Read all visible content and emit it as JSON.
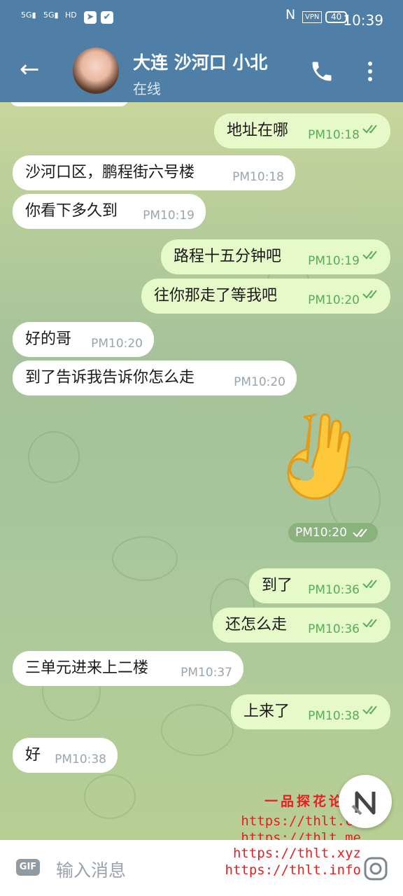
{
  "status_bar": {
    "signal_1": "5G",
    "signal_2": "5G",
    "hd_label": "HD",
    "vpn": "VPN",
    "battery": "40",
    "time": "10:39"
  },
  "header": {
    "name": "大连 沙河口 小北",
    "status": "在线"
  },
  "messages": [
    {
      "dir": "out",
      "text": "地址在哪",
      "time": "PM10:18"
    },
    {
      "dir": "in",
      "text": "沙河口区，鹏程街六号楼",
      "time": "PM10:18"
    },
    {
      "dir": "in",
      "text": "你看下多久到",
      "time": "PM10:19"
    },
    {
      "dir": "out",
      "text": "路程十五分钟吧",
      "time": "PM10:19"
    },
    {
      "dir": "out",
      "text": "往你那走了等我吧",
      "time": "PM10:20"
    },
    {
      "dir": "in",
      "text": "好的哥",
      "time": "PM10:20"
    },
    {
      "dir": "in",
      "text": "到了告诉我告诉你怎么走",
      "time": "PM10:20"
    },
    {
      "dir": "out",
      "type": "sticker",
      "icon": "ok-hand-emoji",
      "time": "PM10:20"
    },
    {
      "dir": "out",
      "text": "到了",
      "time": "PM10:36"
    },
    {
      "dir": "out",
      "text": "还怎么走",
      "time": "PM10:36"
    },
    {
      "dir": "in",
      "text": "三单元进来上二楼",
      "time": "PM10:37"
    },
    {
      "dir": "out",
      "text": "上来了",
      "time": "PM10:38"
    },
    {
      "dir": "in",
      "text": "好",
      "time": "PM10:38"
    }
  ],
  "watermark": {
    "title": "一品探花论坛",
    "links": [
      "https://thlt.cc",
      "https://thlt.me",
      "https://thlt.xyz",
      "https://thlt.info"
    ]
  },
  "input": {
    "gif_label": "GIF",
    "placeholder": "输入消息"
  },
  "colors": {
    "header": "#4f7ea6",
    "outgoing_bubble": "#e6f9c8",
    "incoming_bubble": "#ffffff",
    "tick_green": "#5aab5a",
    "watermark_red": "#e62020"
  }
}
